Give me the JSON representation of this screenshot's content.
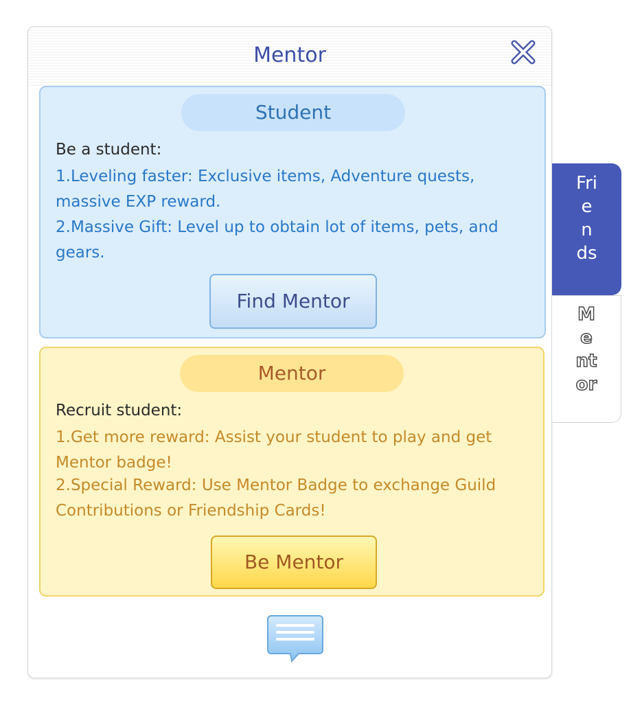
{
  "window": {
    "title": "Mentor"
  },
  "student_card": {
    "heading": "Student",
    "intro": "Be a student:",
    "benefit_1": "1.Leveling faster: Exclusive items, Adventure quests, massive EXP reward.",
    "benefit_2": "2.Massive Gift: Level up to obtain lot of items, pets, and gears.",
    "button_label": "Find Mentor"
  },
  "mentor_card": {
    "heading": "Mentor",
    "intro": "Recruit student:",
    "benefit_1": "1.Get more reward: Assist your student to play and get Mentor badge!",
    "benefit_2": "2.Special Reward: Use Mentor Badge to exchange Guild Contributions or Friendship Cards!",
    "button_label": "Be Mentor"
  },
  "side_tabs": {
    "friends": [
      "Fri",
      "e",
      "n",
      "ds"
    ],
    "mentor": [
      "M",
      "e",
      "nt",
      "or"
    ]
  },
  "icons": {
    "close": "close-x-icon",
    "chat": "chat-bubble-icon"
  },
  "colors": {
    "title": "#3d4fa8",
    "student_bg": "#dcedfb",
    "student_text": "#2a78c9",
    "mentor_bg": "#fff5c8",
    "mentor_text": "#c68a2a",
    "friends_tab": "#4659b7"
  }
}
